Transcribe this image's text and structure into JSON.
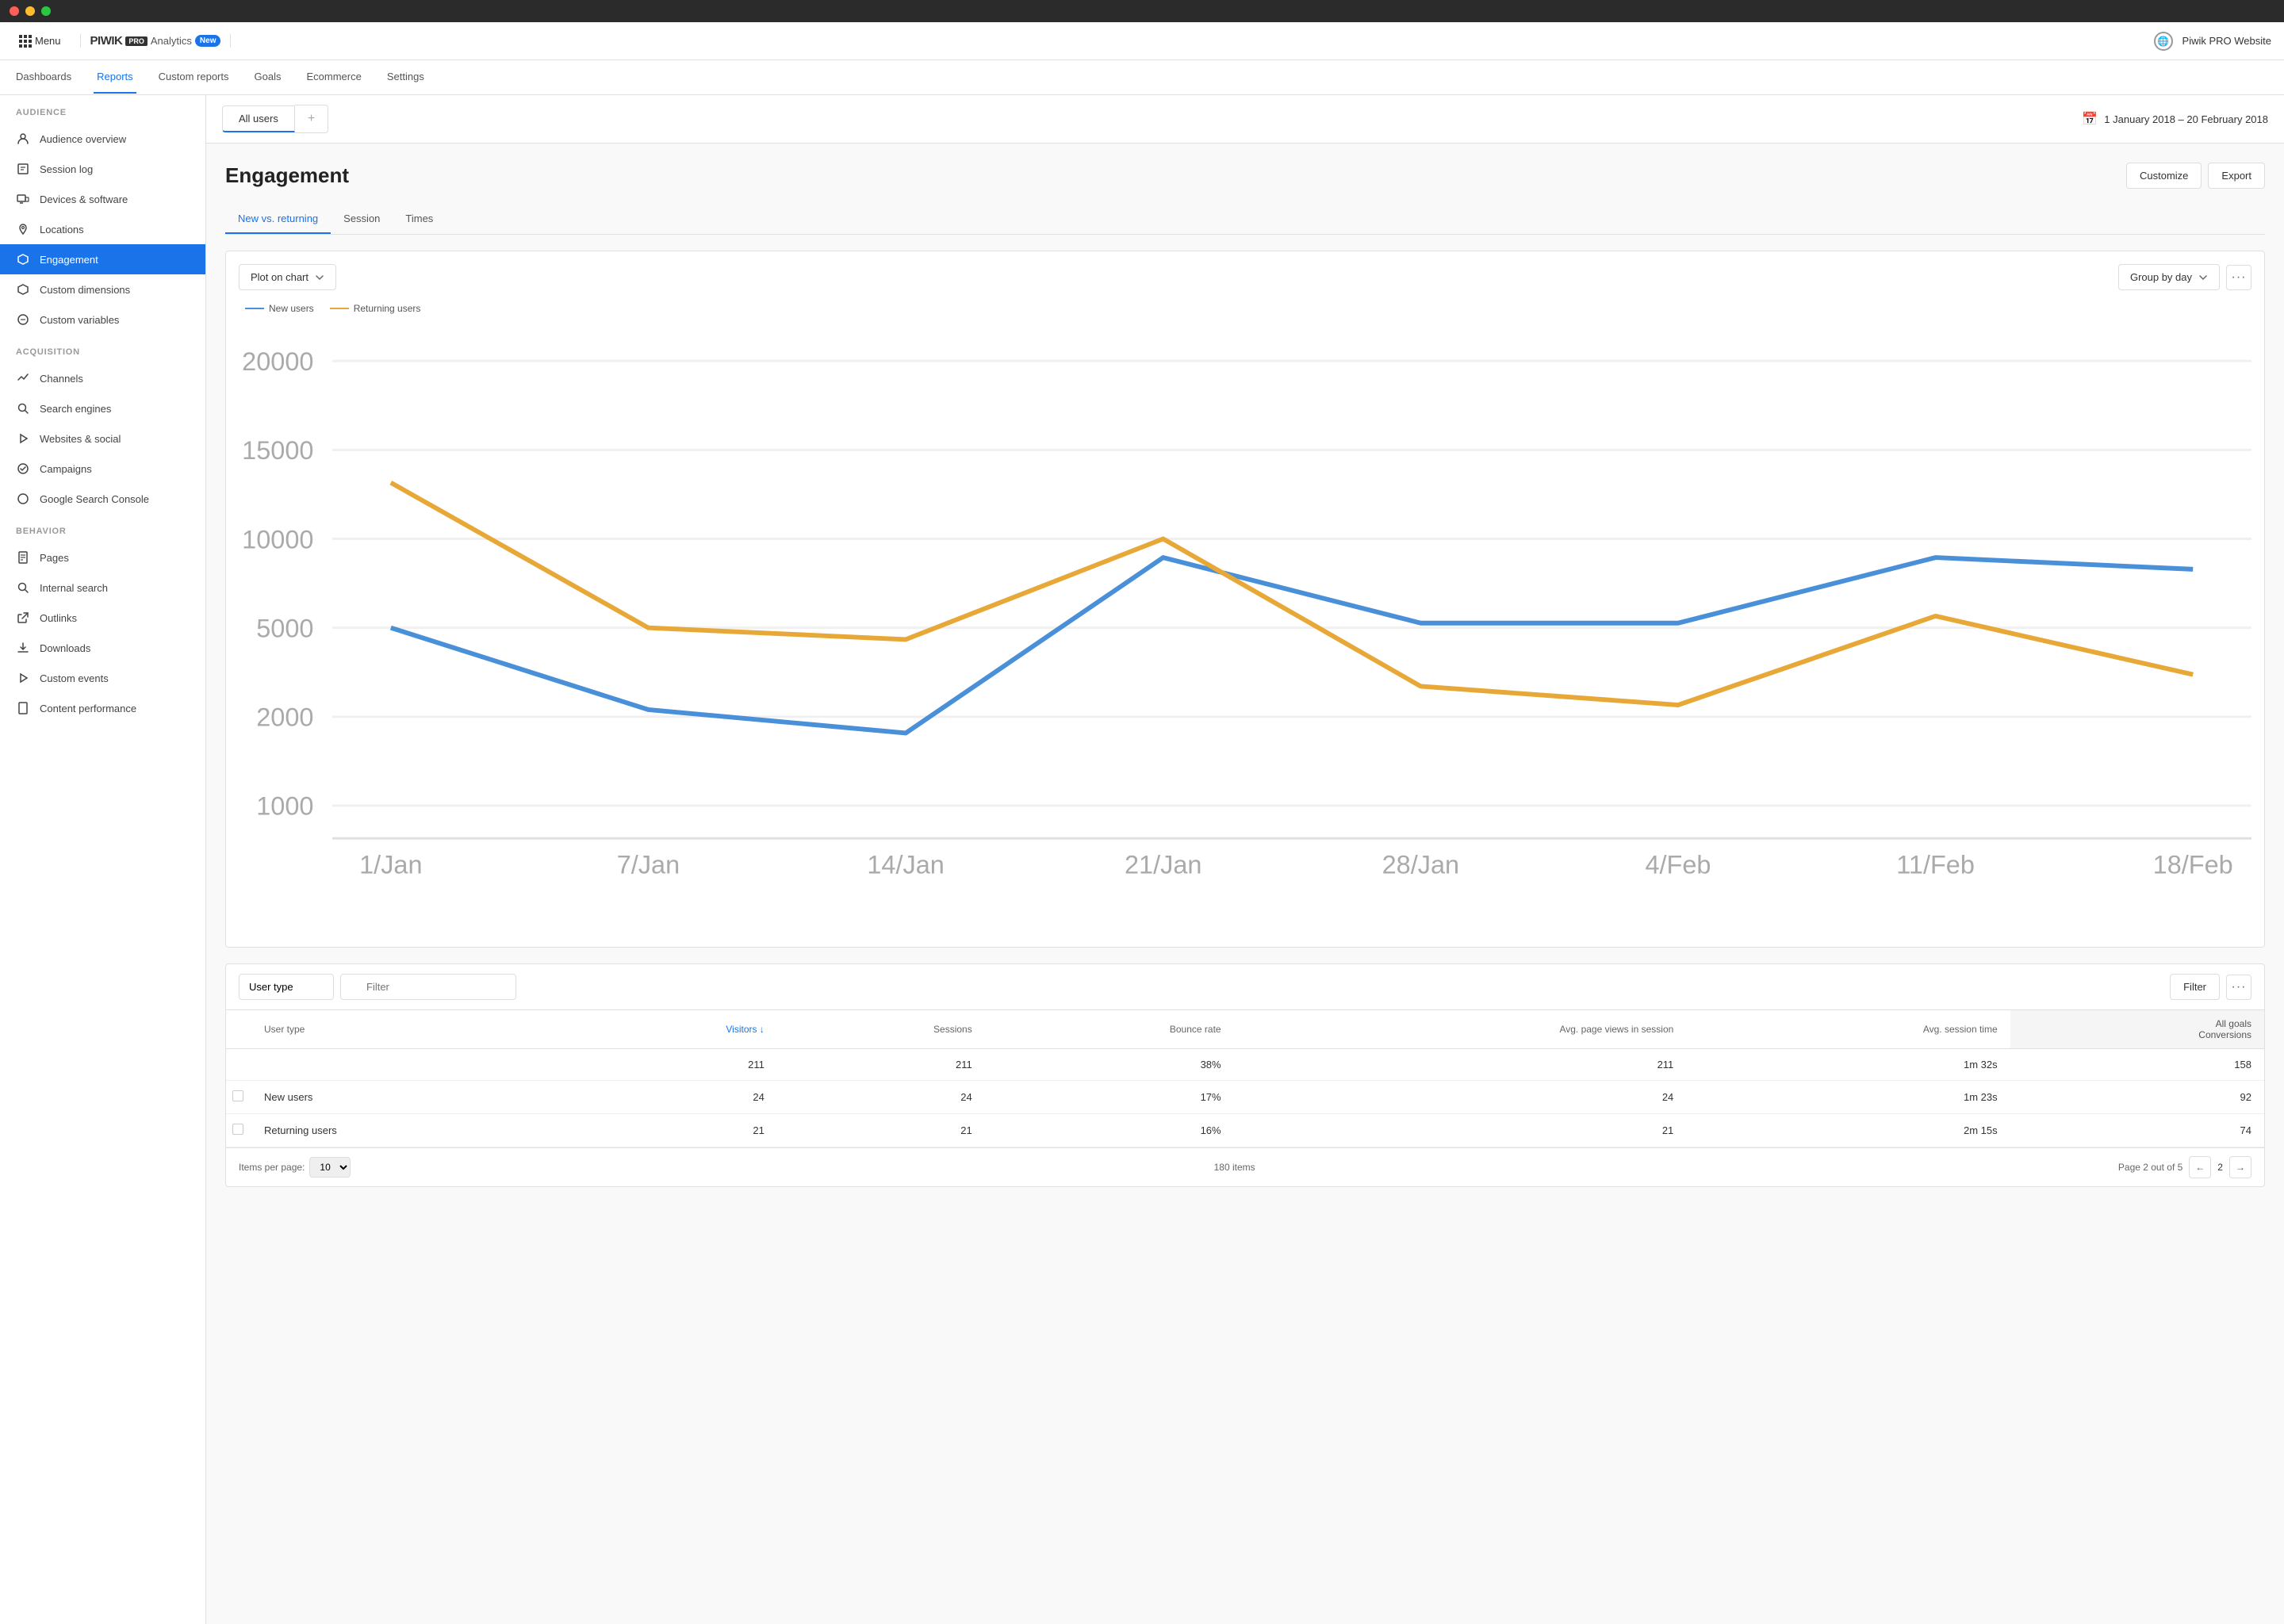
{
  "titlebar": {
    "buttons": [
      "close",
      "minimize",
      "maximize"
    ]
  },
  "topnav": {
    "menu_label": "Menu",
    "logo": "PIWIK",
    "logo_badge": "PRO",
    "analytics": "Analytics",
    "new_badge": "New",
    "site_name": "Piwik PRO Website"
  },
  "secondary_nav": {
    "items": [
      {
        "label": "Dashboards",
        "active": false
      },
      {
        "label": "Reports",
        "active": true
      },
      {
        "label": "Custom reports",
        "active": false
      },
      {
        "label": "Goals",
        "active": false
      },
      {
        "label": "Ecommerce",
        "active": false
      },
      {
        "label": "Settings",
        "active": false
      }
    ]
  },
  "sidebar": {
    "audience": {
      "title": "AUDIENCE",
      "items": [
        {
          "label": "Audience overview",
          "icon": "👤",
          "active": false
        },
        {
          "label": "Session log",
          "icon": "📋",
          "active": false
        },
        {
          "label": "Devices & software",
          "icon": "🖥",
          "active": false
        },
        {
          "label": "Locations",
          "icon": "📍",
          "active": false
        },
        {
          "label": "Engagement",
          "icon": "⬡",
          "active": true
        },
        {
          "label": "Custom dimensions",
          "icon": "⬡",
          "active": false
        },
        {
          "label": "Custom variables",
          "icon": "⬡",
          "active": false
        }
      ]
    },
    "acquisition": {
      "title": "ACQUISITION",
      "items": [
        {
          "label": "Channels",
          "icon": "↗",
          "active": false
        },
        {
          "label": "Search engines",
          "icon": "🔍",
          "active": false
        },
        {
          "label": "Websites & social",
          "icon": "▶",
          "active": false
        },
        {
          "label": "Campaigns",
          "icon": "⚙",
          "active": false
        },
        {
          "label": "Google Search Console",
          "icon": "⬡",
          "active": false
        }
      ]
    },
    "behavior": {
      "title": "BEHAVIOR",
      "items": [
        {
          "label": "Pages",
          "icon": "📄",
          "active": false
        },
        {
          "label": "Internal search",
          "icon": "🔍",
          "active": false
        },
        {
          "label": "Outlinks",
          "icon": "↗",
          "active": false
        },
        {
          "label": "Downloads",
          "icon": "⬇",
          "active": false
        },
        {
          "label": "Custom events",
          "icon": "▶",
          "active": false
        },
        {
          "label": "Content performance",
          "icon": "📄",
          "active": false
        }
      ]
    }
  },
  "segment": {
    "active_tab": "All users",
    "add_label": "+",
    "date_range": "1 January 2018 – 20 February 2018"
  },
  "page": {
    "title": "Engagement",
    "customize_label": "Customize",
    "export_label": "Export"
  },
  "tabs": [
    {
      "label": "New vs. returning",
      "active": true
    },
    {
      "label": "Session",
      "active": false
    },
    {
      "label": "Times",
      "active": false
    }
  ],
  "chart": {
    "plot_label": "Plot on chart",
    "group_label": "Group by day",
    "legend": [
      {
        "label": "New users",
        "color": "#4a90d9"
      },
      {
        "label": "Returning users",
        "color": "#e8a838"
      }
    ],
    "y_labels": [
      "20000",
      "15000",
      "10000",
      "5000",
      "2000",
      "1000"
    ],
    "x_labels": [
      "1/Jan",
      "7/Jan",
      "14/Jan",
      "21/Jan",
      "28/Jan",
      "4/Feb",
      "11/Feb",
      "18/Feb"
    ]
  },
  "table": {
    "user_type_label": "User type",
    "filter_placeholder": "Filter",
    "filter_btn": "Filter",
    "columns": [
      {
        "label": "User type"
      },
      {
        "label": "Visitors ↓",
        "is_blue": true
      },
      {
        "label": "Sessions"
      },
      {
        "label": "Bounce rate"
      },
      {
        "label": "Avg. page views in session"
      },
      {
        "label": "Avg. session time"
      },
      {
        "label": "Conversions"
      }
    ],
    "all_goals_label": "All goals",
    "totals": {
      "visitors": "211",
      "sessions": "211",
      "bounce_rate": "38%",
      "avg_pageviews": "211",
      "avg_session_time": "1m 32s",
      "conversions": "158"
    },
    "rows": [
      {
        "user_type": "New users",
        "visitors": "24",
        "sessions": "24",
        "bounce_rate": "17%",
        "avg_pageviews": "24",
        "avg_session_time": "1m 23s",
        "conversions": "92"
      },
      {
        "user_type": "Returning users",
        "visitors": "21",
        "sessions": "21",
        "bounce_rate": "16%",
        "avg_pageviews": "21",
        "avg_session_time": "2m 15s",
        "conversions": "74"
      }
    ],
    "footer": {
      "items_per_page_label": "Items per page:",
      "items_per_page_value": "10",
      "total_items": "180 items",
      "page_label": "Page 2 out of 5",
      "page_num": "2"
    }
  }
}
